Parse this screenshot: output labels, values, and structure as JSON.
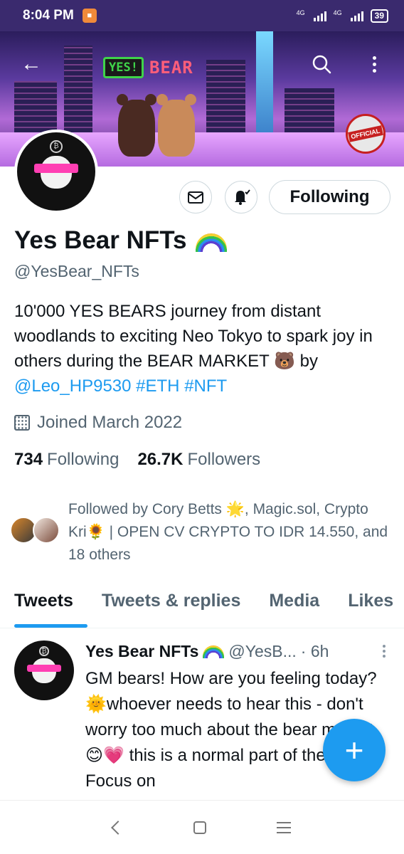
{
  "status_bar": {
    "time": "8:04 PM",
    "network_1": "4G",
    "network_2": "4G",
    "battery": "39"
  },
  "banner": {
    "yes_text": "YES!",
    "bear_text": "BEAR",
    "official_text": "OFFICIAL",
    "back_icon": "arrow-left-icon",
    "search_icon": "search-icon",
    "more_icon": "more-vertical-icon"
  },
  "profile": {
    "name": "Yes Bear NFTs",
    "handle": "@YesBear_NFTs",
    "bio_text": "10'000 YES BEARS journey from distant woodlands to exciting Neo Tokyo to spark joy in others during the BEAR MARKET 🐻 by ",
    "bio_mention": "@Leo_HP9530",
    "bio_tag_1": "#ETH",
    "bio_tag_2": "#NFT",
    "joined": "Joined March 2022",
    "following_count": "734",
    "following_label": "Following",
    "followers_count": "26.7K",
    "followers_label": "Followers",
    "followed_by": "Followed by Cory Betts 🌟, Magic.sol, Crypto Kri🌻 | OPEN CV CRYPTO TO IDR 14.550, and 18 others"
  },
  "actions": {
    "follow_button": "Following",
    "mail_icon": "envelope-icon",
    "bell_icon": "bell-notify-icon"
  },
  "tabs": [
    "Tweets",
    "Tweets & replies",
    "Media",
    "Likes"
  ],
  "tweet": {
    "name": "Yes Bear NFTs",
    "handle": "@YesB...",
    "time": "· 6h",
    "body": "GM bears! How are you feeling today? 🌞whoever needs to hear this - don't worry too much about the bear market 😊💗 this is a normal part of the cycle. Focus on"
  },
  "fab": {
    "label": "+",
    "icon": "compose-plus-icon"
  },
  "colors": {
    "accent": "#1d9bf0",
    "text": "#0f1419",
    "secondary": "#536471",
    "status_bar": "#3a2a6e"
  }
}
